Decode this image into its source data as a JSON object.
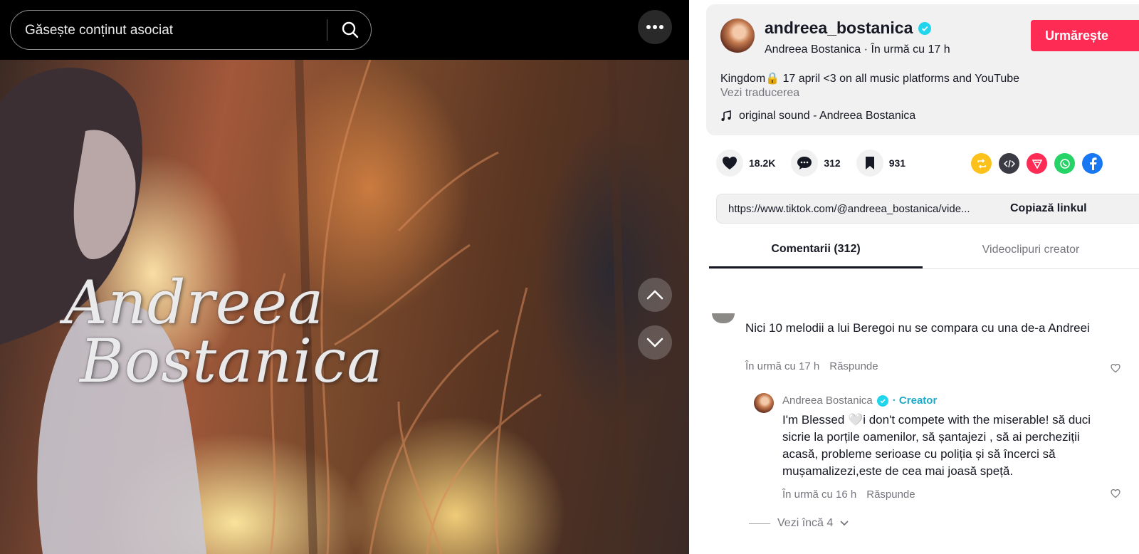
{
  "search": {
    "placeholder": "Găsește conținut asociat"
  },
  "video": {
    "watermark_line1": "Andreea",
    "watermark_line2": "Bostanica"
  },
  "post": {
    "username": "andreea_bostanica",
    "display_name": "Andreea Bostanica",
    "time_ago": "În urmă cu 17 h",
    "follow_label": "Urmărește",
    "description": "Kingdom🔒 17 april <3 on all music platforms and YouTube",
    "translate_label": "Vezi traducerea",
    "sound": "original sound - Andreea Bostanica"
  },
  "actions": {
    "likes": "18.2K",
    "comments": "312",
    "saves": "931"
  },
  "share_icons": [
    "repost-icon",
    "embed-icon",
    "send-icon",
    "whatsapp-icon",
    "facebook-icon"
  ],
  "link": {
    "url": "https://www.tiktok.com/@andreea_bostanica/vide...",
    "copy_label": "Copiază linkul"
  },
  "tabs": {
    "comments": "Comentarii (312)",
    "creator_videos": "Videoclipuri creator"
  },
  "comments": [
    {
      "text": "Nici 10 melodii a lui Beregoi nu se compara cu una de-a Andreei",
      "time": "În urmă cu 17 h",
      "reply_label": "Răspunde"
    }
  ],
  "reply": {
    "author": "Andreea Bostanica",
    "badge": "· Creator",
    "text": "I'm Blessed 🤍i don't compete with the miserable! să duci sicrie la porțile oamenilor, să șantajezi , să ai percheziții acasă, probleme serioase cu poliția și să încerci să mușamalizezi,este de cea mai joasă speță.",
    "time": "În urmă cu 16 h",
    "reply_label": "Răspunde"
  },
  "more_replies_label": "Vezi încă 4",
  "colors": {
    "accent": "#fe2c55",
    "verified": "#20d5ec",
    "muted": "#75767d"
  }
}
